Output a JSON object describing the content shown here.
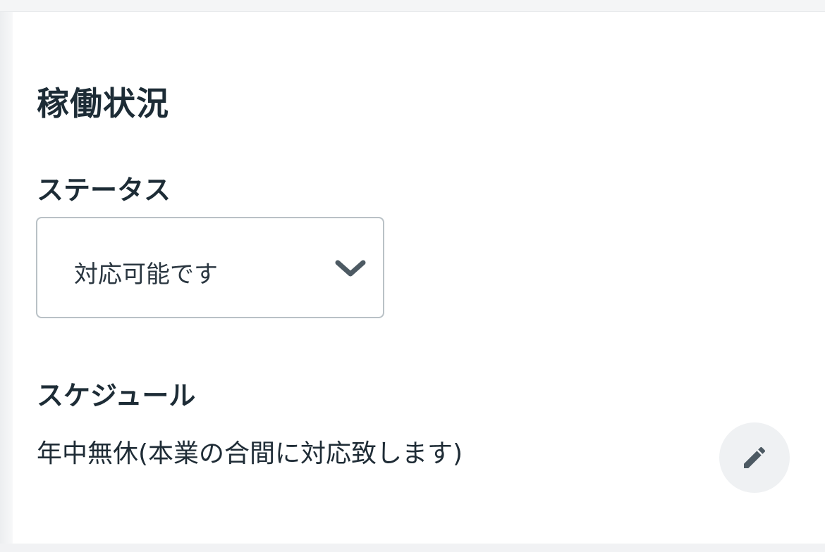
{
  "section": {
    "title": "稼働状況"
  },
  "status": {
    "label": "ステータス",
    "selected_value": "対応可能です",
    "dropdown_icon": "chevron-down-icon"
  },
  "schedule": {
    "label": "スケジュール",
    "text": "年中無休(本業の合間に対応致します)",
    "edit_icon": "pencil-icon"
  },
  "colors": {
    "text": "#1d2c36",
    "select_border": "#b9c1c6",
    "icon": "#4d5a63",
    "edit_button_bg": "#eff1f3"
  }
}
